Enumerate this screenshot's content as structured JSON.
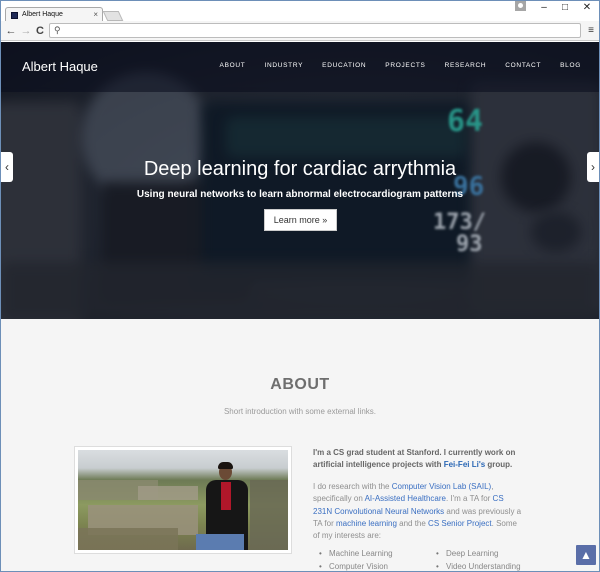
{
  "browser": {
    "tab_title": "Albert Haque",
    "tab_close": "×",
    "back_icon": "←",
    "forward_icon": "→",
    "reload_icon": "C",
    "menu_icon": "≡",
    "search_icon": "🔍",
    "url_value": "",
    "win_minimize": "–",
    "win_maximize": "□",
    "win_close": "✕"
  },
  "header": {
    "brand": "Albert Haque",
    "nav": [
      "ABOUT",
      "INDUSTRY",
      "EDUCATION",
      "PROJECTS",
      "RESEARCH",
      "CONTACT",
      "BLOG"
    ]
  },
  "hero": {
    "title": "Deep learning for cardiac arrythmia",
    "subtitle": "Using neural networks to learn abnormal electrocardiogram patterns",
    "button": "Learn more »",
    "prev_icon": "‹",
    "next_icon": "›",
    "monitor_numbers": [
      "64",
      "96",
      "173/",
      "93"
    ]
  },
  "about": {
    "title": "ABOUT",
    "subtitle": "Short introduction with some external links.",
    "lead_prefix": "I'm a CS grad student at Stanford. I currently work on artificial intelligence projects with ",
    "lead_link": "Fei-Fei Li's",
    "lead_suffix": " group.",
    "body": {
      "t1": "I do research with the ",
      "l1": "Computer Vision Lab (SAIL)",
      "t2": ", specifically on ",
      "l2": "AI-Assisted Healthcare",
      "t3": ". I'm a TA for ",
      "l3": "CS 231N Convolutional Neural Networks",
      "t4": " and was previously a TA for ",
      "l4": "machine learning",
      "t5": " and the ",
      "l5": "CS Senior Project",
      "t6": ". Some of my interests are:"
    },
    "interests_left": [
      "Machine Learning",
      "Computer Vision"
    ],
    "interests_right": [
      "Deep Learning",
      "Video Understanding"
    ]
  },
  "scroll_top_icon": "▲",
  "colors": {
    "link": "#3a6fc2",
    "scroll_top": "#5a6ea8",
    "window_border": "#6d8fb8"
  }
}
